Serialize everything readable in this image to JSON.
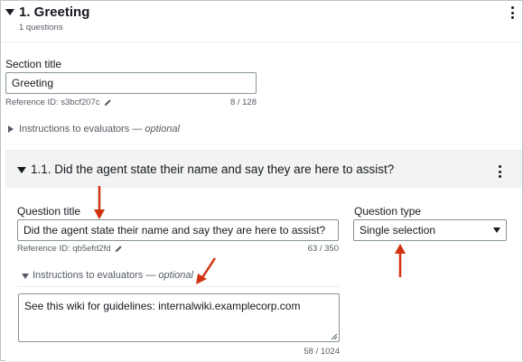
{
  "section": {
    "title": "1. Greeting",
    "subtitle": "1 questions",
    "field_label": "Section title",
    "field_value": "Greeting",
    "reference": "Reference ID: s3bcf207c",
    "char_count": "8 / 128",
    "instructions_label": "Instructions to evaluators",
    "instructions_optional": "— optional"
  },
  "question": {
    "heading": "1.1. Did the agent state their name and say they are here to assist?",
    "title_label": "Question title",
    "title_value": "Did the agent state their name and say they are here to assist?",
    "reference": "Reference ID: qb5efd2fd",
    "char_count": "63 / 350",
    "type_label": "Question type",
    "type_value": "Single selection",
    "instructions_label": "Instructions to evaluators",
    "instructions_optional": "— optional",
    "instructions_value": "See this wiki for guidelines: internalwiki.examplecorp.com",
    "instructions_count": "58 / 1024"
  },
  "colors": {
    "annotation_arrow": "#d13212",
    "border": "#879596",
    "panel_bg": "#f2f3f3"
  },
  "icons": [
    "caret-down-icon",
    "caret-right-icon",
    "kebab-menu-icon",
    "pencil-icon",
    "dropdown-caret-icon",
    "resize-handle-icon",
    "annotation-arrow"
  ]
}
